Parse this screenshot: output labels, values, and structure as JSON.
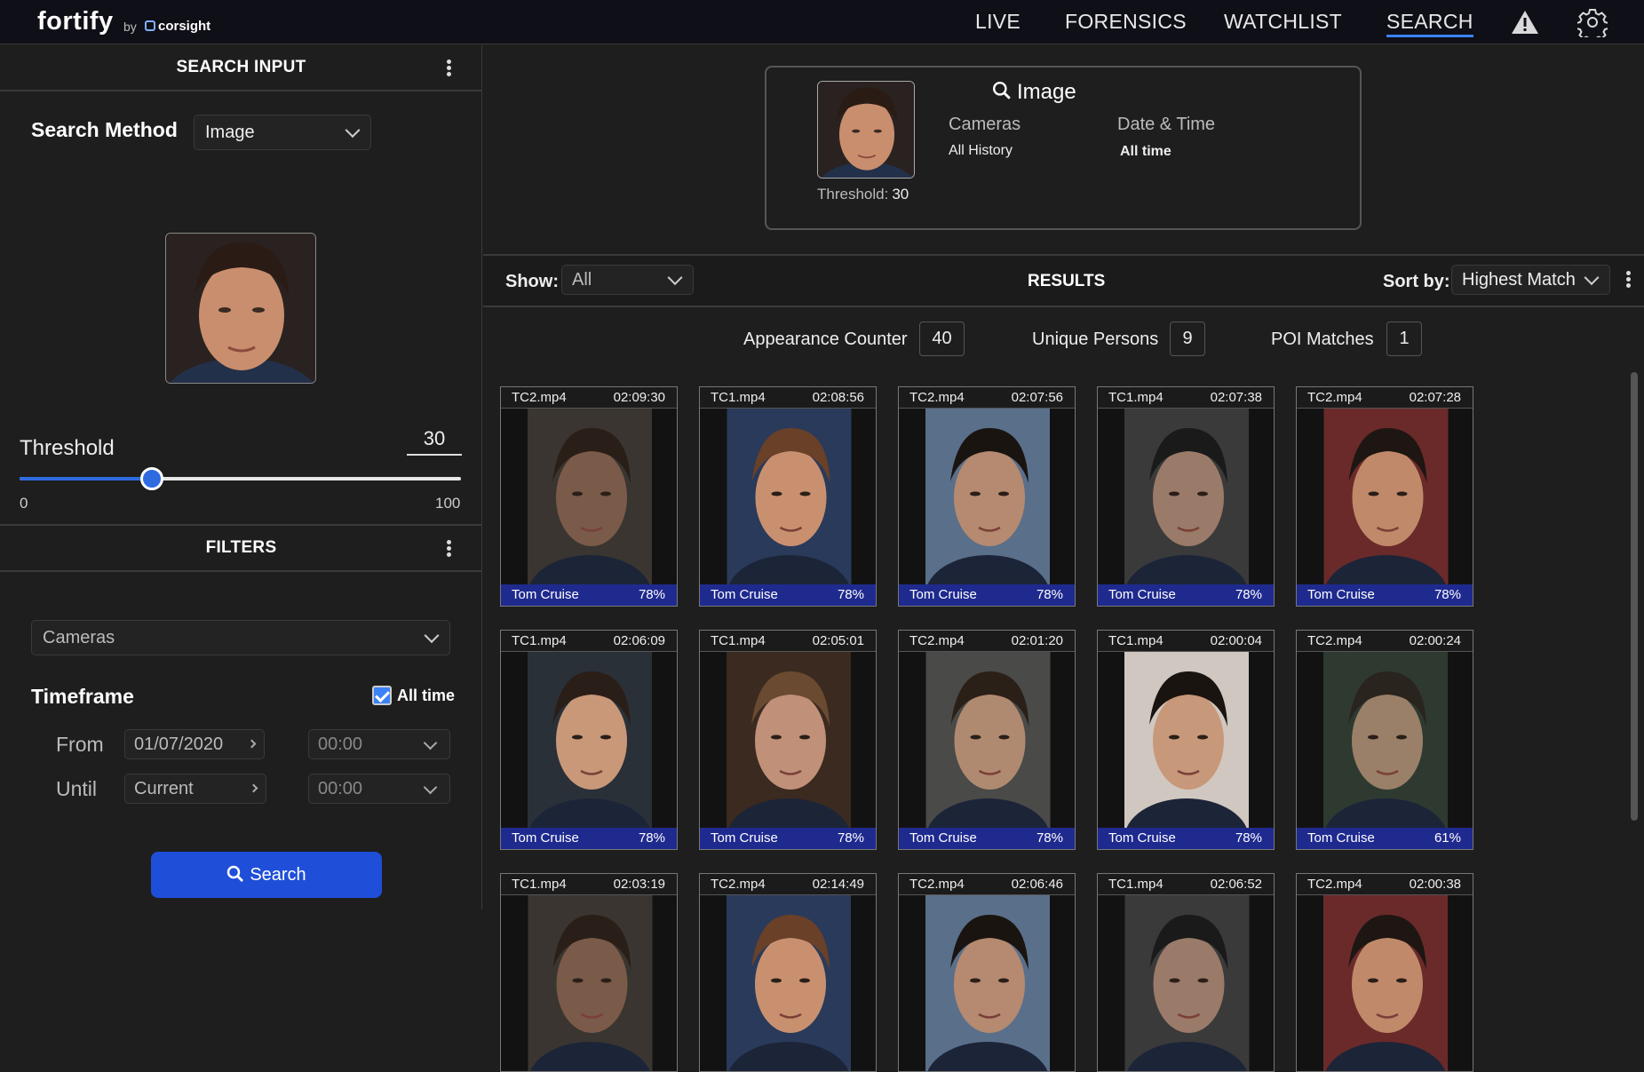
{
  "header": {
    "brand": "fortify",
    "by": "by",
    "partner": "corsight",
    "nav": [
      "LIVE",
      "FORENSICS",
      "WATCHLIST",
      "SEARCH"
    ],
    "active_nav": "SEARCH",
    "icons": [
      "warning-icon",
      "gear-icon"
    ]
  },
  "search_input": {
    "title": "SEARCH INPUT",
    "method_label": "Search Method",
    "method_value": "Image",
    "threshold_label": "Threshold",
    "threshold_value": "30",
    "threshold_level": 30,
    "slider_min": "0",
    "slider_max": "100"
  },
  "filters": {
    "title": "FILTERS",
    "cameras_placeholder": "Cameras",
    "timeframe_label": "Timeframe",
    "all_time_label": "All time",
    "all_time_checked": true,
    "from_label": "From",
    "from_date": "01/07/2020",
    "from_time": "00:00",
    "until_label": "Until",
    "until_date": "Current",
    "until_time": "00:00",
    "search_button": "Search"
  },
  "summary": {
    "title": "Image",
    "cameras_label": "Cameras",
    "cameras_value": "All History",
    "datetime_label": "Date & Time",
    "datetime_value": "All time",
    "threshold_label": "Threshold:",
    "threshold_value": "30"
  },
  "results": {
    "show_label": "Show:",
    "show_value": "All",
    "title": "RESULTS",
    "sort_label": "Sort by:",
    "sort_value": "Highest Match",
    "appearance_label": "Appearance Counter",
    "appearance_value": "40",
    "unique_label": "Unique Persons",
    "unique_value": "9",
    "poi_label": "POI Matches",
    "poi_value": "1",
    "tiles": [
      {
        "file": "TC2.mp4",
        "time": "02:09:30",
        "name": "Tom Cruise",
        "pct": "78%"
      },
      {
        "file": "TC1.mp4",
        "time": "02:08:56",
        "name": "Tom Cruise",
        "pct": "78%"
      },
      {
        "file": "TC2.mp4",
        "time": "02:07:56",
        "name": "Tom Cruise",
        "pct": "78%"
      },
      {
        "file": "TC1.mp4",
        "time": "02:07:38",
        "name": "Tom Cruise",
        "pct": "78%"
      },
      {
        "file": "TC2.mp4",
        "time": "02:07:28",
        "name": "Tom Cruise",
        "pct": "78%"
      },
      {
        "file": "TC1.mp4",
        "time": "02:06:09",
        "name": "Tom Cruise",
        "pct": "78%"
      },
      {
        "file": "TC1.mp4",
        "time": "02:05:01",
        "name": "Tom Cruise",
        "pct": "78%"
      },
      {
        "file": "TC2.mp4",
        "time": "02:01:20",
        "name": "Tom Cruise",
        "pct": "78%"
      },
      {
        "file": "TC1.mp4",
        "time": "02:00:04",
        "name": "Tom Cruise",
        "pct": "78%"
      },
      {
        "file": "TC2.mp4",
        "time": "02:00:24",
        "name": "Tom Cruise",
        "pct": "61%"
      },
      {
        "file": "TC1.mp4",
        "time": "02:03:19"
      },
      {
        "file": "TC2.mp4",
        "time": "02:14:49"
      },
      {
        "file": "TC2.mp4",
        "time": "02:06:46"
      },
      {
        "file": "TC1.mp4",
        "time": "02:06:52"
      },
      {
        "file": "TC2.mp4",
        "time": "02:00:38"
      }
    ]
  }
}
